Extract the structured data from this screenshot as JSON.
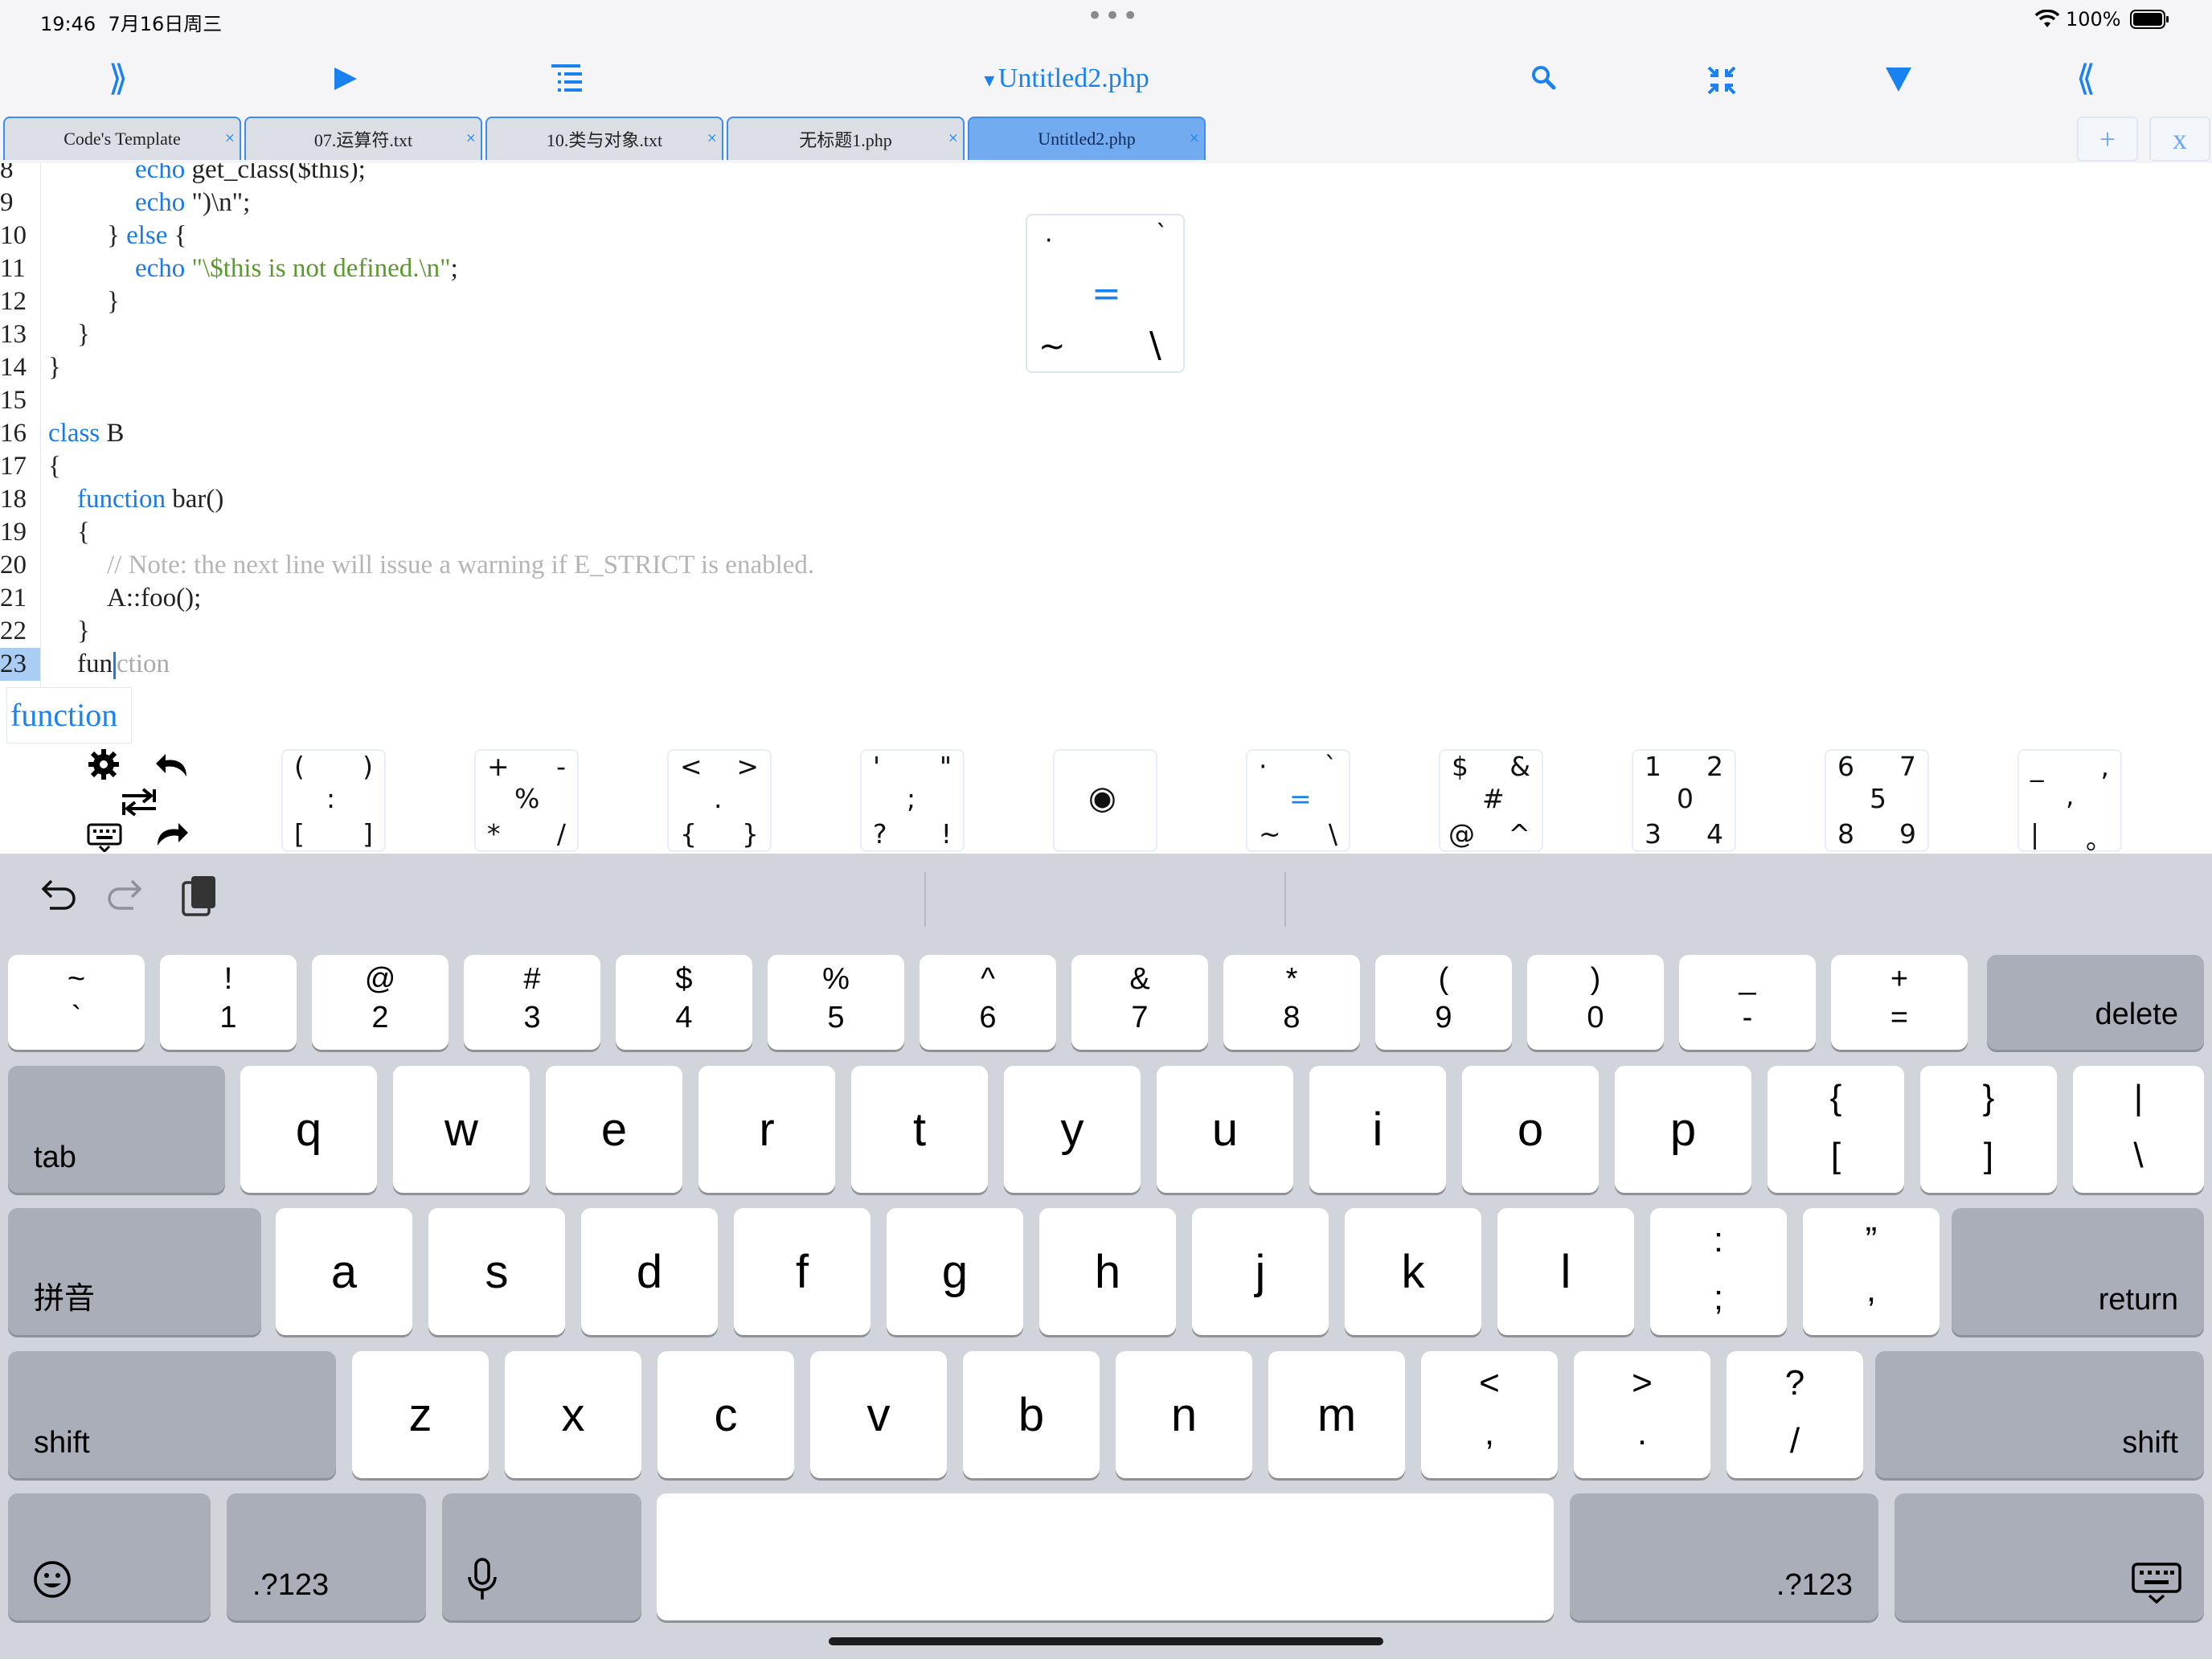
{
  "status_bar": {
    "time": "19:46",
    "date": "7月16日周三",
    "battery": "100%"
  },
  "toolbar": {
    "file_title": "Untitled2.php"
  },
  "tabs": [
    {
      "label": "Code's Template"
    },
    {
      "label": "07.运算符.txt"
    },
    {
      "label": "10.类与对象.txt"
    },
    {
      "label": "无标题1.php"
    },
    {
      "label": "Untitled2.php",
      "active": true
    }
  ],
  "tab_buttons": {
    "add": "+",
    "close": "x"
  },
  "tab_close": "×",
  "editor": {
    "line_numbers": [
      "8",
      "9",
      "10",
      "11",
      "12",
      "13",
      "14",
      "15",
      "16",
      "17",
      "18",
      "19",
      "20",
      "21",
      "22",
      "23"
    ],
    "lines": {
      "l8a": "echo",
      "l8b": " get_class($this);",
      "l9a": "echo",
      "l9b": " \")\\n\";",
      "l10a": "} ",
      "l10b": "else",
      "l10c": " {",
      "l11a": "echo",
      "l11b": " \"\\$this is not defined.\\n\"",
      "l11c": ";",
      "l12": "}",
      "l13": "}",
      "l14": "}",
      "l16a": "class",
      "l16b": " B",
      "l17": "{",
      "l18a": "function",
      "l18b": " bar()",
      "l19": "{",
      "l20": "// Note: the next line will issue a warning if E_STRICT is enabled.",
      "l21": "A::foo();",
      "l22": "}",
      "l23_typed": "fun",
      "l23_ghost": "ction"
    },
    "suggestion": "function"
  },
  "popup": {
    "tl": "·",
    "tr": "`",
    "center": "=",
    "bl": "~",
    "br": "\\"
  },
  "symbol_bar": [
    {
      "tl": "(",
      "tr": ")",
      "c": ":",
      "bl": "[",
      "br": "]"
    },
    {
      "tl": "+",
      "tr": "-",
      "c": "%",
      "bl": "*",
      "br": "/"
    },
    {
      "tl": "<",
      "tr": ">",
      "c": ".",
      "bl": "{",
      "br": "}"
    },
    {
      "tl": "'",
      "tr": "\"",
      "c": ";",
      "bl": "?",
      "br": "!"
    },
    {
      "tl": "",
      "tr": "",
      "c": "◉",
      "bl": "",
      "br": ""
    },
    {
      "tl": "·",
      "tr": "`",
      "c": "=",
      "bl": "~",
      "br": "\\"
    },
    {
      "tl": "$",
      "tr": "&",
      "c": "#",
      "bl": "@",
      "br": "^"
    },
    {
      "tl": "1",
      "tr": "2",
      "c": "0",
      "bl": "3",
      "br": "4"
    },
    {
      "tl": "6",
      "tr": "7",
      "c": "5",
      "bl": "8",
      "br": "9"
    },
    {
      "tl": "_",
      "tr": ",",
      "c": ",",
      "bl": "|",
      "br": "。"
    }
  ],
  "keyboard": {
    "row1": [
      {
        "t": "~",
        "b": "`"
      },
      {
        "t": "!",
        "b": "1"
      },
      {
        "t": "@",
        "b": "2"
      },
      {
        "t": "#",
        "b": "3"
      },
      {
        "t": "$",
        "b": "4"
      },
      {
        "t": "%",
        "b": "5"
      },
      {
        "t": "^",
        "b": "6"
      },
      {
        "t": "&",
        "b": "7"
      },
      {
        "t": "*",
        "b": "8"
      },
      {
        "t": "(",
        "b": "9"
      },
      {
        "t": ")",
        "b": "0"
      },
      {
        "t": "_",
        "b": "-"
      },
      {
        "t": "+",
        "b": "="
      }
    ],
    "delete": "delete",
    "tab": "tab",
    "row2": [
      "q",
      "w",
      "e",
      "r",
      "t",
      "y",
      "u",
      "i",
      "o",
      "p"
    ],
    "row2_sym": [
      {
        "t": "{",
        "b": "["
      },
      {
        "t": "}",
        "b": "]"
      },
      {
        "t": "|",
        "b": "\\"
      }
    ],
    "pinyin": "拼音",
    "row3": [
      "a",
      "s",
      "d",
      "f",
      "g",
      "h",
      "j",
      "k",
      "l"
    ],
    "row3_sym": [
      {
        "t": ":",
        "b": ";"
      },
      {
        "t": "”",
        "b": ","
      }
    ],
    "return": "return",
    "shift": "shift",
    "row4": [
      "z",
      "x",
      "c",
      "v",
      "b",
      "n",
      "m"
    ],
    "row4_sym": [
      {
        "t": "<",
        "b": ","
      },
      {
        "t": ">",
        "b": "."
      },
      {
        "t": "?",
        "b": "/"
      }
    ],
    "numbers": ".?123"
  },
  "colors": {
    "accent": "#1a82f0",
    "keyword": "#1a7ae6",
    "string": "#5a9a2a",
    "comment": "#b5b5b5"
  }
}
